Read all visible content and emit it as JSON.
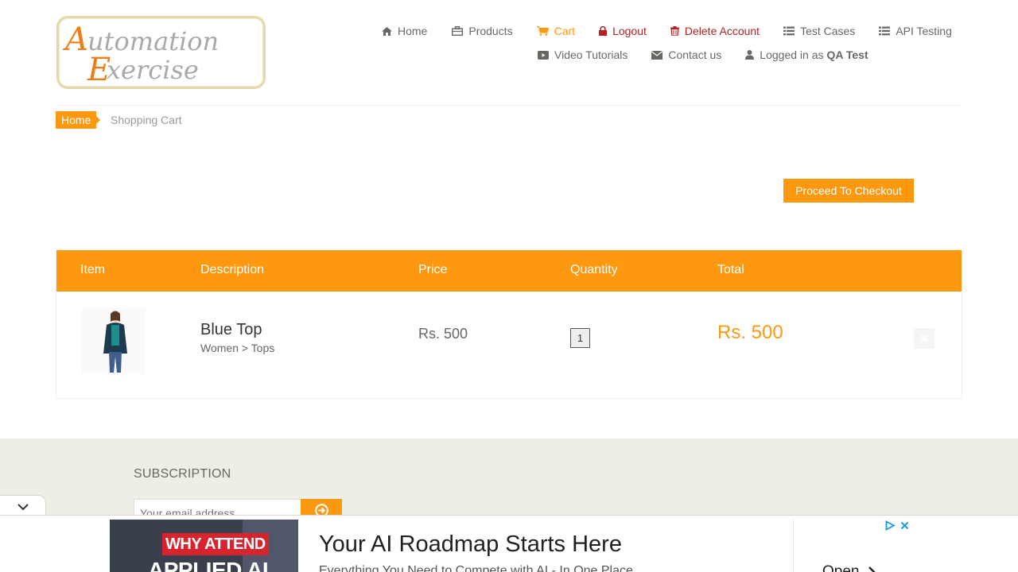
{
  "logo": {
    "text_line1": "Automation",
    "text_line2": "Exercise"
  },
  "nav": {
    "home": "Home",
    "products": "Products",
    "cart": "Cart",
    "logout": "Logout",
    "delete_account": "Delete Account",
    "test_cases": "Test Cases",
    "api_testing": "API Testing",
    "video_tutorials": "Video Tutorials",
    "contact_us": "Contact us",
    "logged_in_as": "Logged in as",
    "username": "QA Test"
  },
  "breadcrumb": {
    "home": "Home",
    "current": "Shopping Cart"
  },
  "checkout_label": "Proceed To Checkout",
  "cart": {
    "headers": {
      "item": "Item",
      "description": "Description",
      "price": "Price",
      "quantity": "Quantity",
      "total": "Total"
    },
    "items": [
      {
        "name": "Blue Top",
        "category": "Women > Tops",
        "price": "Rs. 500",
        "quantity": "1",
        "total": "Rs. 500"
      }
    ]
  },
  "footer": {
    "subscription_title": "SUBSCRIPTION",
    "email_placeholder": "Your email address"
  },
  "ad": {
    "image_line1": "WHY ATTEND",
    "image_line2": "APPLIED AI",
    "headline": "Your AI Roadmap Starts Here",
    "subtext": "Everything You Need to Compete with AI - In One Place",
    "open_label": "Open"
  },
  "colors": {
    "accent": "#FE980F",
    "danger": "#b22222",
    "footer_bg": "#eeeee6"
  },
  "icons": {
    "home": "home-icon",
    "products": "briefcase-icon",
    "cart": "cart-icon",
    "logout": "lock-icon",
    "delete": "trash-icon",
    "test_cases": "list-icon",
    "api": "list-icon",
    "video": "youtube-play-icon",
    "contact": "envelope-icon",
    "user": "user-icon",
    "remove": "close-icon",
    "subscribe": "arrow-circle-right-icon"
  }
}
